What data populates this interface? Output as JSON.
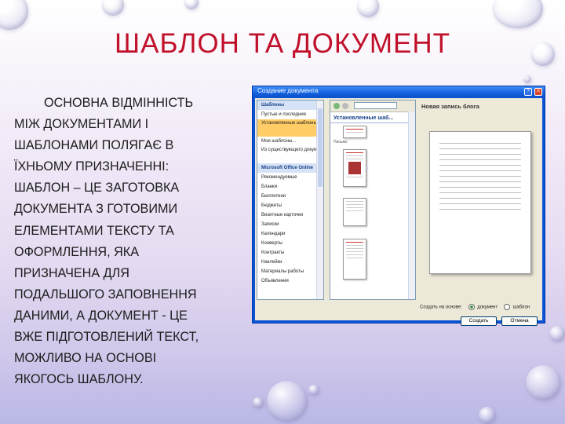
{
  "slide": {
    "title": "ШАБЛОН ТА ДОКУМЕНТ",
    "body_lines": [
      "ОСНОВНА ВІДМІННІСТЬ",
      "МІЖ ДОКУМЕНТАМИ І",
      "ШАБЛОНАМИ ПОЛЯГАЄ В",
      "ЇХНЬОМУ ПРИЗНАЧЕННІ:",
      "ШАБЛОН – ЦЕ ЗАГОТОВКА",
      "ДОКУМЕНТА З ГОТОВИМИ",
      "ЕЛЕМЕНТАМИ ТЕКСТУ ТА",
      "ОФОРМЛЕННЯ, ЯКА",
      "ПРИЗНАЧЕНА ДЛЯ",
      "ПОДАЛЬШОГО ЗАПОВНЕННЯ",
      "ДАНИМИ, А ДОКУМЕНТ - ЦЕ",
      "ВЖЕ ПІДГОТОВЛЕНИЙ ТЕКСТ,",
      "МОЖЛИВО НА ОСНОВІ",
      "ЯКОГОСЬ ШАБЛОНУ."
    ],
    "title_color": "#c0102a"
  },
  "dialog": {
    "title": "Создание документа",
    "help_glyph": "?",
    "close_glyph": "×",
    "left_items": [
      {
        "label": "Шаблоны",
        "kind": "head"
      },
      {
        "label": "Пустые и последние",
        "kind": "item"
      },
      {
        "label": "Установленные шаблоны",
        "kind": "sel"
      },
      {
        "label": "Мои шаблоны...",
        "kind": "item"
      },
      {
        "label": "Из существующего документа...",
        "kind": "two"
      },
      {
        "label": "Microsoft Office Online",
        "kind": "head"
      },
      {
        "label": "Рекомендуемые",
        "kind": "item"
      },
      {
        "label": "Бланки",
        "kind": "item"
      },
      {
        "label": "Бюллетени",
        "kind": "item"
      },
      {
        "label": "Бюджеты",
        "kind": "item"
      },
      {
        "label": "Визитные карточки",
        "kind": "item"
      },
      {
        "label": "Записки",
        "kind": "item"
      },
      {
        "label": "Календари",
        "kind": "item"
      },
      {
        "label": "Конверты",
        "kind": "item"
      },
      {
        "label": "Контракты",
        "kind": "item"
      },
      {
        "label": "Наклейки",
        "kind": "item"
      },
      {
        "label": "Материалы работы",
        "kind": "item"
      },
      {
        "label": "Объявления",
        "kind": "item"
      }
    ],
    "mid_heading": "Установленные шаб...",
    "thumb_captions": [
      "Письмо",
      "",
      "",
      ""
    ],
    "preview_title": "Новая запись блога",
    "create_from_label": "Создать на основе:",
    "radio_document": "документ",
    "radio_template": "шаблон",
    "create_button": "Создать",
    "cancel_button": "Отмена"
  }
}
